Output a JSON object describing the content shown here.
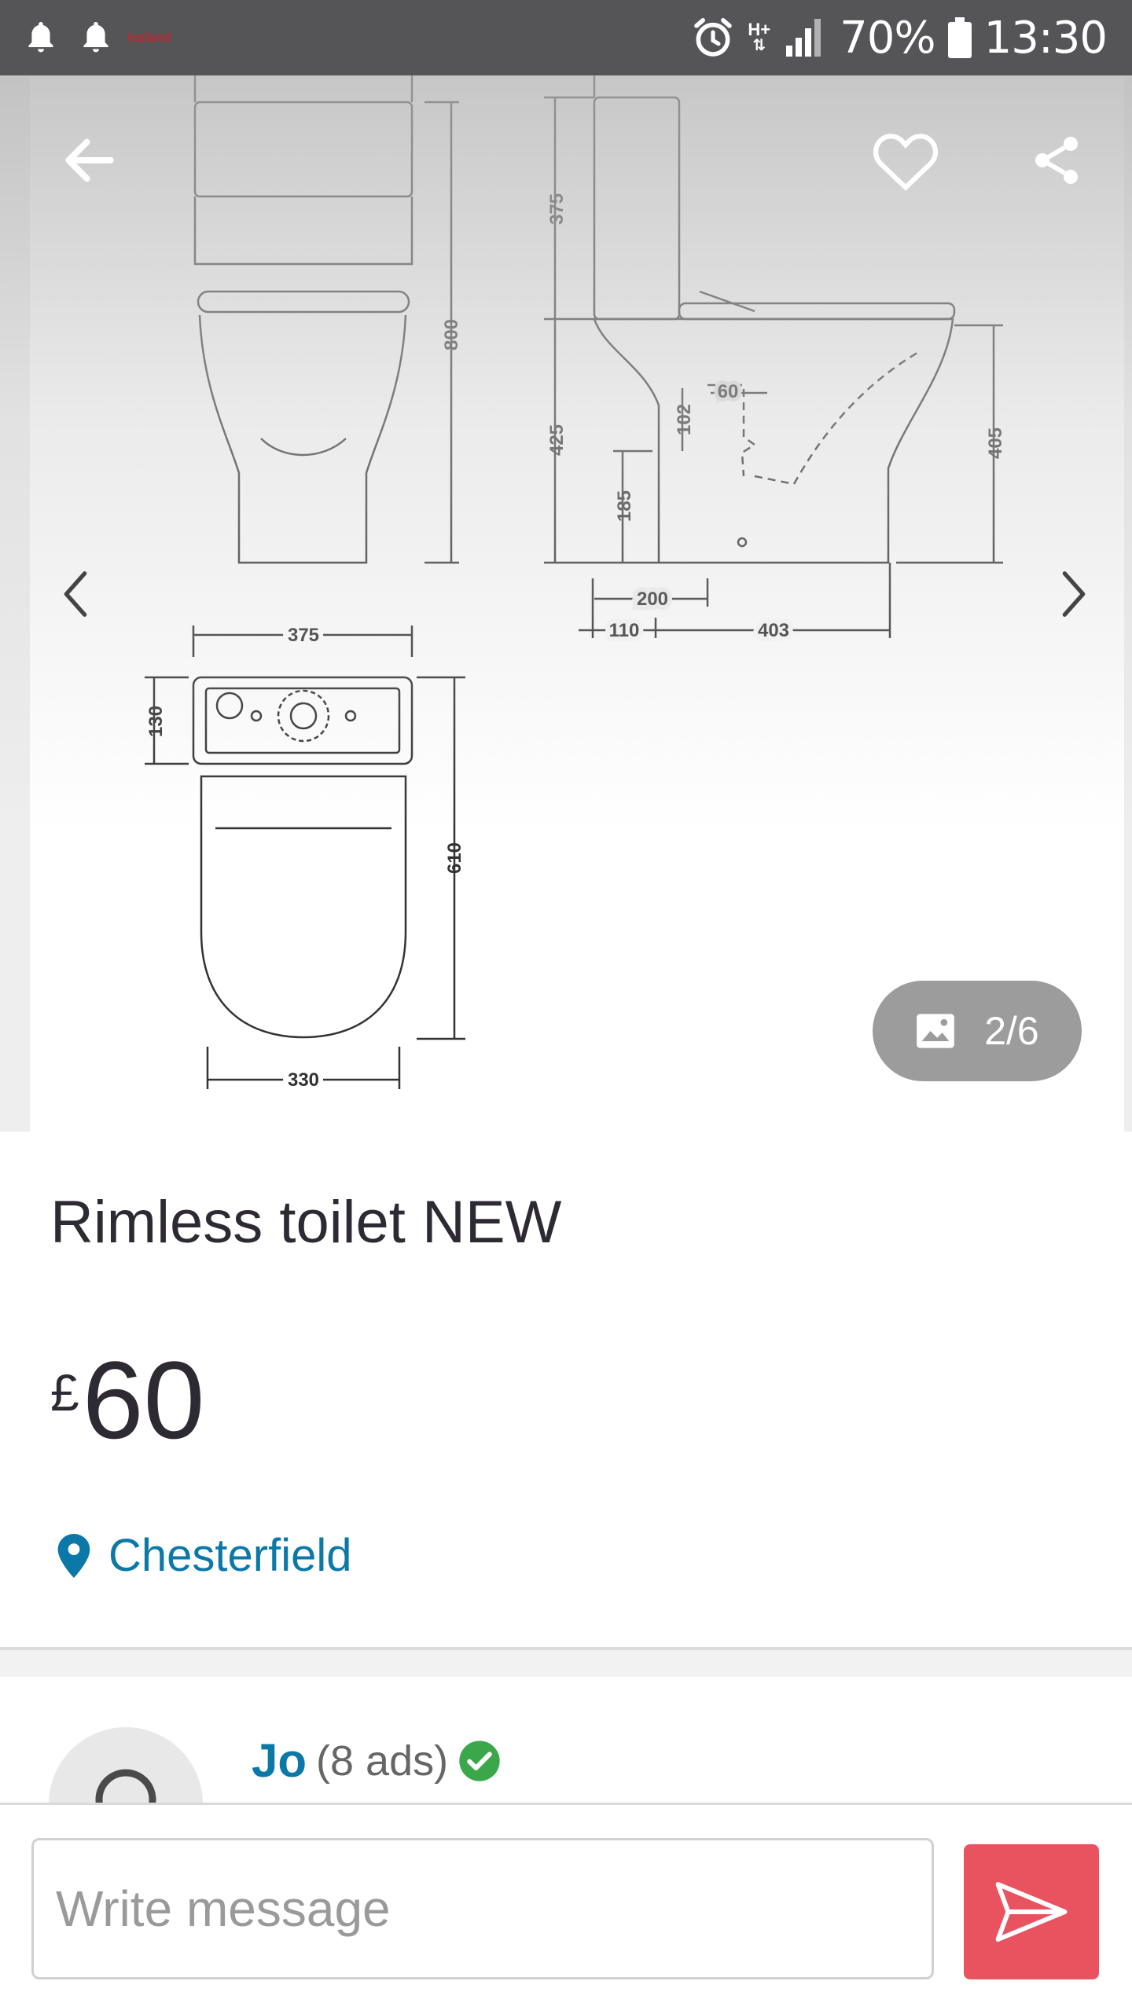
{
  "status_bar": {
    "brand_label": "Iceland",
    "network_type": "H+",
    "battery": "70%",
    "time": "13:30"
  },
  "gallery": {
    "counter": "2/6",
    "dimensions": {
      "front_tank_width": "375",
      "front_height": "800",
      "side_tank_depth": "130",
      "side_tank_height": "375",
      "side_pan_height": "425",
      "outlet_height": "185",
      "outlet_offset": "102",
      "outlet_width": "60",
      "seat_height": "405",
      "base_200": "200",
      "base_110": "110",
      "base_403": "403",
      "top_tank_width": "375",
      "top_tank_depth": "130",
      "top_pan_length": "610",
      "top_pan_width": "330"
    }
  },
  "listing": {
    "title": "Rimless toilet NEW",
    "currency": "£",
    "price": "60",
    "location": "Chesterfield"
  },
  "seller": {
    "name": "Jo",
    "ads_count": "(8 ads)"
  },
  "composer": {
    "placeholder": "Write message"
  },
  "colors": {
    "accent_link": "#0b78a8",
    "send_button": "#e9525f",
    "verified": "#3aa84a",
    "status_bar": "#555557"
  },
  "icons": {
    "back": "arrow-left-icon",
    "favourite": "heart-icon",
    "share": "share-icon",
    "prev": "chevron-left-icon",
    "next": "chevron-right-icon",
    "gallery": "image-icon",
    "location": "map-pin-icon",
    "verified": "check-circle-icon",
    "send": "send-icon"
  }
}
